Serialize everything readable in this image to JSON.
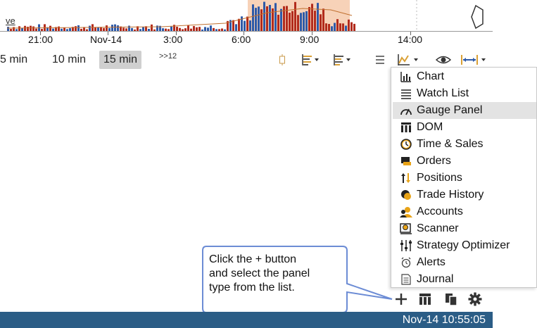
{
  "chart_strip": {
    "partial_label": "ve",
    "highlight_color": "#f7d2b8",
    "bar_colors": {
      "up": "#2e5aa8",
      "down": "#b22b1c"
    }
  },
  "time_axis": {
    "labels": [
      "21:00",
      "Nov-14",
      "3:00",
      "6:00",
      "9:00",
      "14:00"
    ]
  },
  "interval_bar": {
    "items": [
      {
        "label": "5 min",
        "selected": false
      },
      {
        "label": "10 min",
        "selected": false
      },
      {
        "label": "15 min",
        "selected": true
      }
    ],
    "more_label": ">>12"
  },
  "toolbar_icons": [
    "candle-icon",
    "bar-style-icon",
    "study-icon",
    "list-icon",
    "drawing-icon",
    "eye-icon",
    "width-icon"
  ],
  "panel_menu": {
    "items": [
      {
        "label": "Chart",
        "icon": "chart-icon"
      },
      {
        "label": "Watch List",
        "icon": "watch-list-icon"
      },
      {
        "label": "Gauge Panel",
        "icon": "gauge-icon",
        "highlighted": true
      },
      {
        "label": "DOM",
        "icon": "dom-icon"
      },
      {
        "label": "Time & Sales",
        "icon": "time-sales-icon"
      },
      {
        "label": "Orders",
        "icon": "orders-icon"
      },
      {
        "label": "Positions",
        "icon": "positions-icon"
      },
      {
        "label": "Trade History",
        "icon": "trade-history-icon"
      },
      {
        "label": "Accounts",
        "icon": "accounts-icon"
      },
      {
        "label": "Scanner",
        "icon": "scanner-icon"
      },
      {
        "label": "Strategy Optimizer",
        "icon": "strategy-optimizer-icon"
      },
      {
        "label": "Alerts",
        "icon": "alerts-icon"
      },
      {
        "label": "Journal",
        "icon": "journal-icon"
      }
    ]
  },
  "callout": {
    "lines": [
      "Click the + button",
      "and select the panel",
      "type from the list."
    ]
  },
  "bottom_tools": [
    "plus-icon",
    "layout-icon",
    "copy-icon",
    "gear-icon"
  ],
  "status_bar": {
    "datetime": "Nov-14 10:55:05",
    "color": "#2b5d86"
  }
}
